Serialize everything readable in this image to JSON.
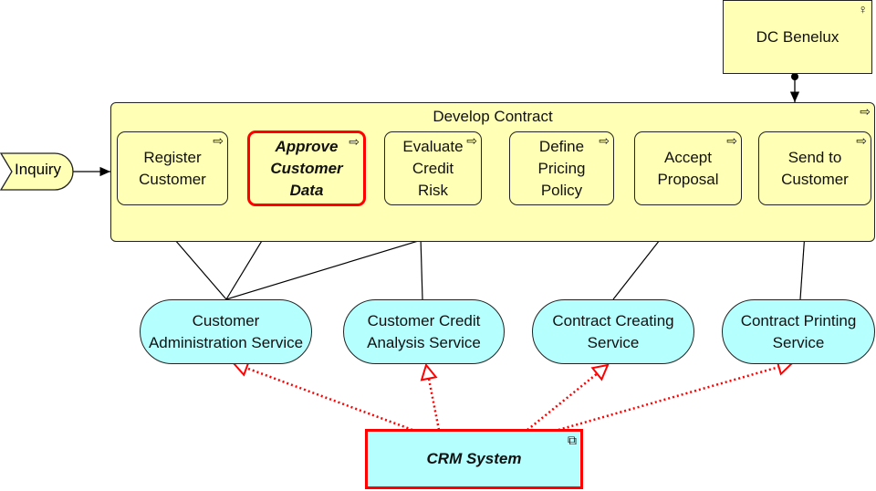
{
  "actor": {
    "label": "DC Benelux",
    "icon": "actor-icon"
  },
  "event": {
    "label": "Inquiry"
  },
  "process": {
    "label": "Develop Contract",
    "icon": "process-arrow-icon"
  },
  "steps": [
    {
      "label": "Register Customer"
    },
    {
      "label": "Approve Customer Data",
      "highlighted": true
    },
    {
      "label": "Evaluate Credit Risk"
    },
    {
      "label": "Define Pricing Policy"
    },
    {
      "label": "Accept Proposal"
    },
    {
      "label": "Send to Customer"
    }
  ],
  "services": [
    {
      "label": "Customer Administration Service"
    },
    {
      "label": "Customer Credit Analysis Service"
    },
    {
      "label": "Contract Creating Service"
    },
    {
      "label": "Contract Printing Service"
    }
  ],
  "component": {
    "label": "CRM System",
    "icon": "component-icon",
    "highlighted": true
  },
  "colors": {
    "business": "#ffffb5",
    "application": "#b5ffff",
    "highlight": "#ff0000"
  }
}
